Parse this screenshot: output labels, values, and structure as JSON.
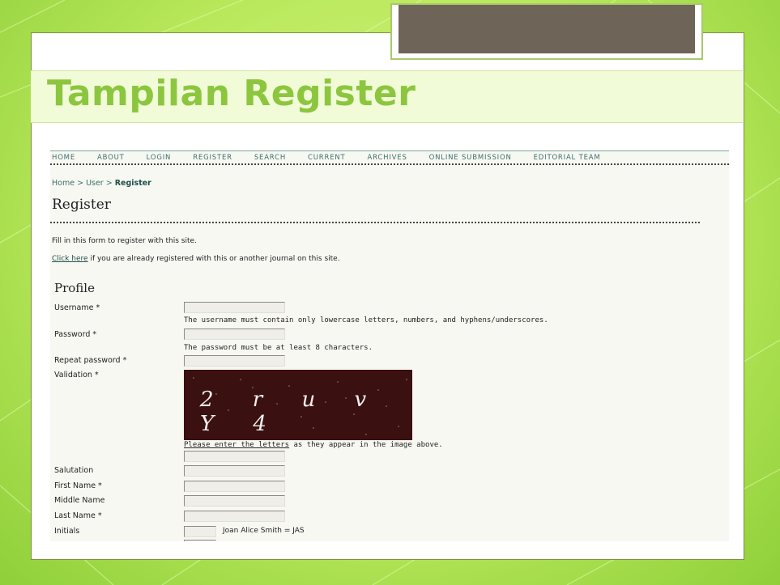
{
  "slide": {
    "title": "Tampilan Register"
  },
  "nav": [
    "HOME",
    "ABOUT",
    "LOGIN",
    "REGISTER",
    "SEARCH",
    "CURRENT",
    "ARCHIVES",
    "ONLINE SUBMISSION",
    "EDITORIAL TEAM"
  ],
  "breadcrumb": {
    "home": "Home",
    "sep1": " > ",
    "user": "User",
    "sep2": " > ",
    "current": "Register"
  },
  "page": {
    "heading": "Register",
    "intro": "Fill in this form to register with this site.",
    "click_here": "Click here",
    "already": " if you are already registered with this or another journal on this site.",
    "profile_heading": "Profile"
  },
  "form": {
    "username_label": "Username *",
    "username_note": "The username must contain only lowercase letters, numbers, and hyphens/underscores.",
    "password_label": "Password *",
    "password_note": "The password must be at least 8 characters.",
    "repeat_password_label": "Repeat password *",
    "validation_label": "Validation *",
    "captcha_text": "2 r u v Y 4",
    "captcha_note_link": "Please enter the letters",
    "captcha_note_rest": " as they appear in the image above.",
    "salutation_label": "Salutation",
    "first_name_label": "First Name *",
    "middle_name_label": "Middle Name",
    "last_name_label": "Last Name *",
    "initials_label": "Initials",
    "initials_note": "Joan Alice Smith = JAS"
  }
}
